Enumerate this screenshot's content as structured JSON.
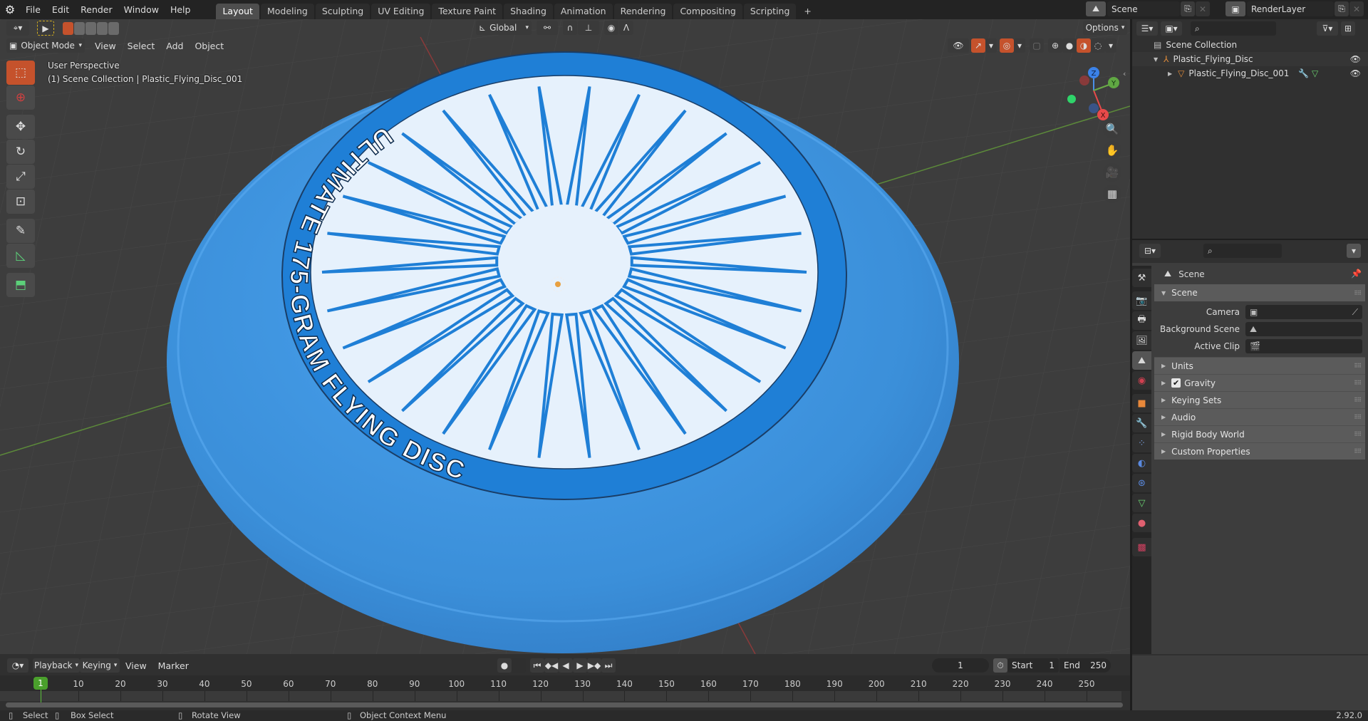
{
  "topbar": {
    "logo_icon": "blender-logo-icon",
    "menus": [
      "File",
      "Edit",
      "Render",
      "Window",
      "Help"
    ],
    "workspaces": [
      "Layout",
      "Modeling",
      "Sculpting",
      "UV Editing",
      "Texture Paint",
      "Shading",
      "Animation",
      "Rendering",
      "Compositing",
      "Scripting"
    ],
    "active_workspace": "Layout",
    "add_workspace": "+",
    "scene_name": "Scene",
    "view_layer_name": "RenderLayer"
  },
  "viewport_header": {
    "mode": "Object Mode",
    "menus": [
      "View",
      "Select",
      "Add",
      "Object"
    ],
    "transform_orientation": "Global",
    "options_label": "Options"
  },
  "viewport": {
    "view_name": "User Perspective",
    "context": "(1) Scene Collection | Plastic_Flying_Disc_001",
    "disc_text": "ULTIMATE 175-GRAM FLYING DISC",
    "disc_color": "#3b8fd9",
    "gizmo_axes": [
      "Z",
      "Y",
      "X"
    ],
    "tools": [
      "select-box",
      "cursor",
      "move",
      "rotate",
      "scale",
      "transform",
      "annotate",
      "measure",
      "add-cube"
    ]
  },
  "outliner": {
    "root": "Scene Collection",
    "items": [
      {
        "name": "Plastic_Flying_Disc",
        "type": "empty",
        "expanded": true,
        "visible": true
      },
      {
        "name": "Plastic_Flying_Disc_001",
        "type": "mesh",
        "expanded": false,
        "visible": true
      }
    ]
  },
  "properties": {
    "context_title": "Scene",
    "panel_title": "Scene",
    "fields": [
      {
        "label": "Camera",
        "value": ""
      },
      {
        "label": "Background Scene",
        "value": ""
      },
      {
        "label": "Active Clip",
        "value": ""
      }
    ],
    "subpanels": [
      "Units",
      "Gravity",
      "Keying Sets",
      "Audio",
      "Rigid Body World",
      "Custom Properties"
    ],
    "gravity_checked": true
  },
  "timeline": {
    "menus": [
      "Playback",
      "Keying",
      "View",
      "Marker"
    ],
    "current_frame": "1",
    "start_label": "Start",
    "start": "1",
    "end_label": "End",
    "end": "250",
    "ticks": [
      "1",
      "10",
      "20",
      "30",
      "40",
      "50",
      "60",
      "70",
      "80",
      "90",
      "100",
      "110",
      "120",
      "130",
      "140",
      "150",
      "160",
      "170",
      "180",
      "190",
      "200",
      "210",
      "220",
      "230",
      "240",
      "250"
    ]
  },
  "statusbar": {
    "select": "Select",
    "box_select": "Box Select",
    "rotate_view": "Rotate View",
    "context_menu": "Object Context Menu",
    "version": "2.92.0"
  }
}
